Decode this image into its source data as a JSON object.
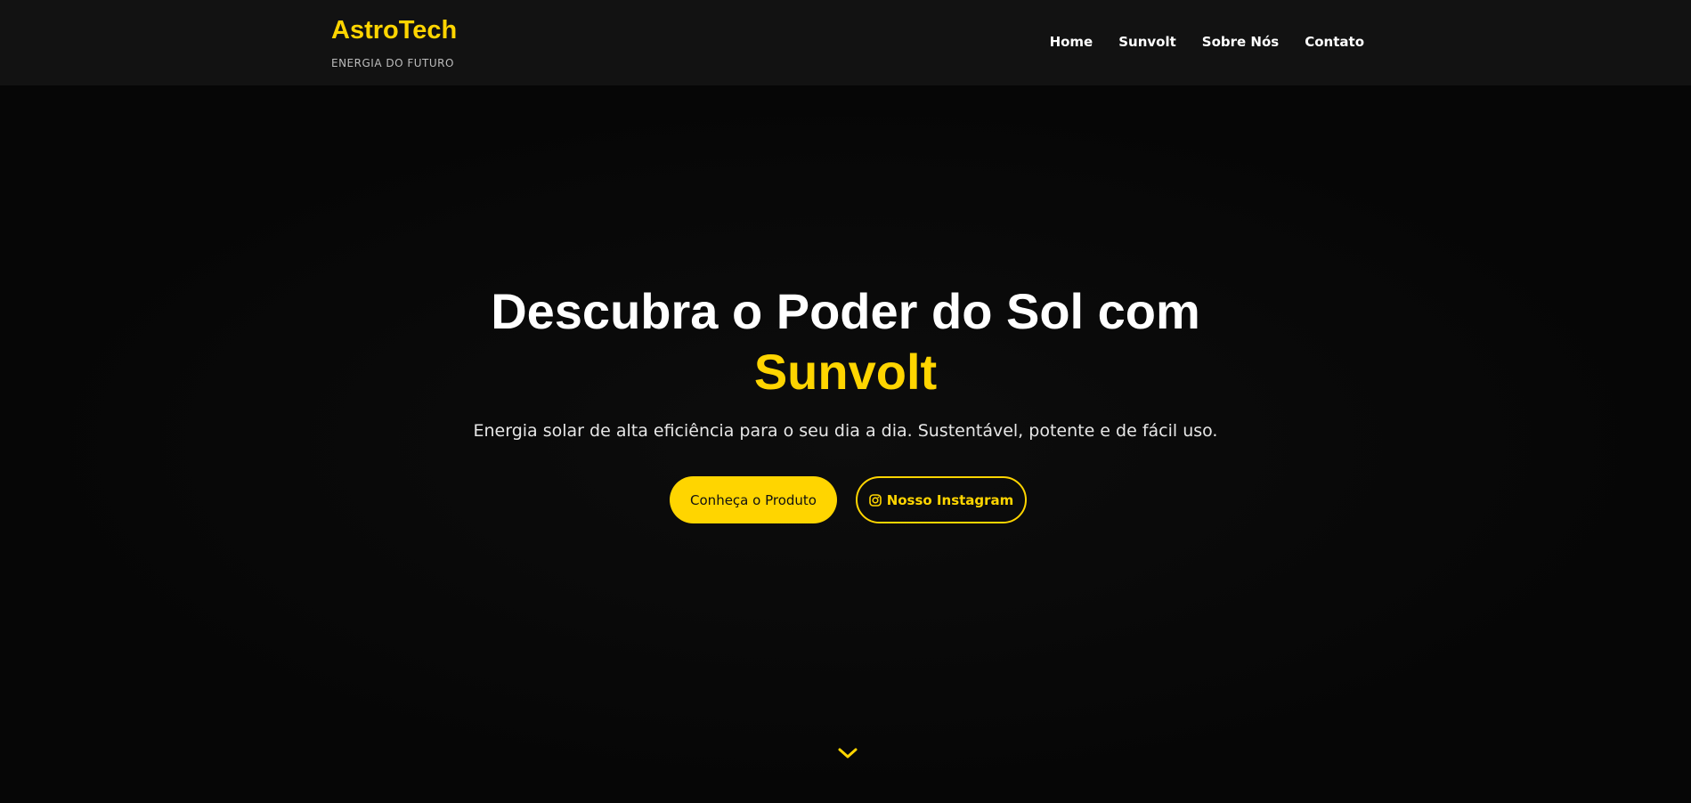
{
  "brand": {
    "name": "AstroTech",
    "tagline": "ENERGIA DO FUTURO"
  },
  "nav": {
    "items": [
      {
        "label": "Home"
      },
      {
        "label": "Sunvolt"
      },
      {
        "label": "Sobre Nós"
      },
      {
        "label": "Contato"
      }
    ]
  },
  "hero": {
    "title_line1": "Descubra o Poder do Sol com",
    "title_accent": "Sunvolt",
    "subtitle": "Energia solar de alta eficiência para o seu dia a dia. Sustentável, potente e de fácil uso.",
    "primary_button": "Conheça o Produto",
    "instagram_button": "Nosso Instagram"
  },
  "icons": {
    "instagram": "instagram-icon",
    "scroll": "chevron-down-icon"
  },
  "colors": {
    "accent": "#ffd500",
    "header_bg": "#121212",
    "page_bg": "#070707",
    "text": "#ffffff"
  }
}
